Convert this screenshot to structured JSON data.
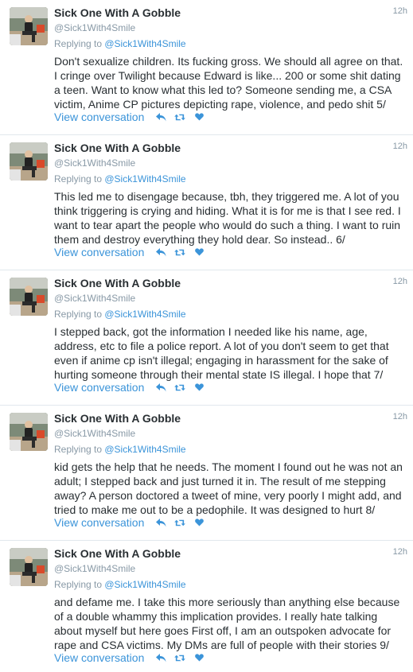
{
  "colors": {
    "link": "#3b94d9",
    "muted": "#8899a6",
    "text": "#292f33",
    "divider": "#e1e8ed"
  },
  "icons": [
    "reply-icon",
    "retweet-icon",
    "like-icon"
  ],
  "tweets": [
    {
      "name": "Sick One With A Gobble",
      "handle": "@Sick1With4Smile",
      "time": "12h",
      "replying_prefix": "Replying to ",
      "replying_to": "@Sick1With4Smile",
      "text": "Don't sexualize children. Its fucking gross. We should all agree on that. I cringe over Twilight because Edward is like... 200 or some shit dating a teen. Want to know what this led to? Someone sending me, a CSA victim, Anime CP pictures depicting rape, violence, and pedo shit 5/",
      "view_conversation": "View conversation"
    },
    {
      "name": "Sick One With A Gobble",
      "handle": "@Sick1With4Smile",
      "time": "12h",
      "replying_prefix": "Replying to ",
      "replying_to": "@Sick1With4Smile",
      "text": "This led me to disengage because, tbh, they triggered me. A lot of you think triggering is crying and hiding. What it is for me is that I see red. I want to tear apart the people who would do such a thing. I want to ruin them and destroy everything they hold dear. So instead.. 6/",
      "view_conversation": "View conversation"
    },
    {
      "name": "Sick One With A Gobble",
      "handle": "@Sick1With4Smile",
      "time": "12h",
      "replying_prefix": "Replying to ",
      "replying_to": "@Sick1With4Smile",
      "text": "I stepped back, got the information I needed like his name, age, address, etc to file a police report. A lot of you don't seem to get that even if anime cp isn't illegal; engaging in harassment for the sake of hurting someone through their mental state IS illegal. I hope that 7/",
      "view_conversation": "View conversation"
    },
    {
      "name": "Sick One With A Gobble",
      "handle": "@Sick1With4Smile",
      "time": "12h",
      "replying_prefix": "Replying to ",
      "replying_to": "@Sick1With4Smile",
      "text": "kid gets the help that he needs. The moment I found out he was not an adult; I stepped back and just turned it in. The result of me stepping away? A person doctored a tweet of mine, very poorly I might add, and tried to make me out to be a pedophile. It was designed to hurt 8/",
      "view_conversation": "View conversation"
    },
    {
      "name": "Sick One With A Gobble",
      "handle": "@Sick1With4Smile",
      "time": "12h",
      "replying_prefix": "Replying to ",
      "replying_to": "@Sick1With4Smile",
      "text": "and defame me. I take this more seriously than anything else because of a double whammy this implication provides. I really hate talking about myself but here goes First off, I am an outspoken advocate for rape and CSA victims. My DMs are full of people with their stories 9/",
      "view_conversation": "View conversation"
    }
  ]
}
